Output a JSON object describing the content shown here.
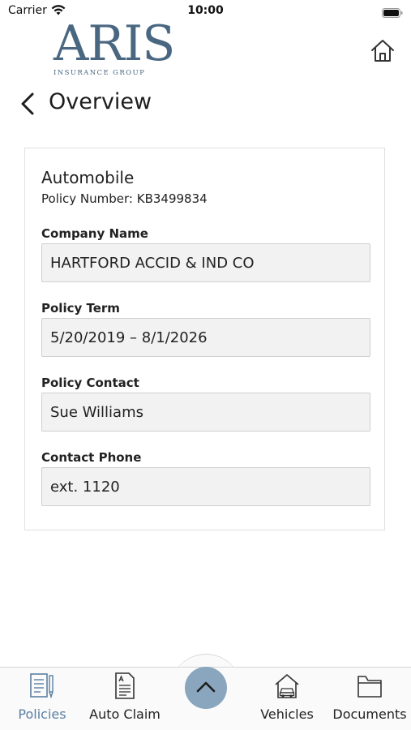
{
  "status_bar": {
    "carrier": "Carrier",
    "time": "10:00"
  },
  "header": {
    "logo_text": "ARIS",
    "logo_subtitle": "INSURANCE GROUP",
    "home_icon": "home-icon"
  },
  "page": {
    "title": "Overview",
    "back_icon": "chevron-left-icon"
  },
  "policy": {
    "type": "Automobile",
    "number_label": "Policy Number:",
    "number": "KB3499834",
    "fields": [
      {
        "label": "Company Name",
        "value": "HARTFORD ACCID & IND CO"
      },
      {
        "label": "Policy Term",
        "value": "5/20/2019 – 8/1/2026"
      },
      {
        "label": "Policy Contact",
        "value": "Sue Williams"
      },
      {
        "label": "Contact Phone",
        "value": "ext. 1120"
      }
    ]
  },
  "tab_bar": {
    "tabs": [
      {
        "label": "Policies",
        "icon": "policies-icon",
        "active": true
      },
      {
        "label": "Auto Claim",
        "icon": "auto-claim-icon",
        "active": false
      },
      {
        "label": "Vehicles",
        "icon": "vehicles-icon",
        "active": false
      },
      {
        "label": "Documents",
        "icon": "documents-icon",
        "active": false
      }
    ],
    "center_icon": "chevron-up-icon"
  },
  "colors": {
    "brand": "#4a6781",
    "active_tab": "#5a7fa3",
    "center_button": "#8aa6bf",
    "field_background": "#f2f2f2"
  }
}
